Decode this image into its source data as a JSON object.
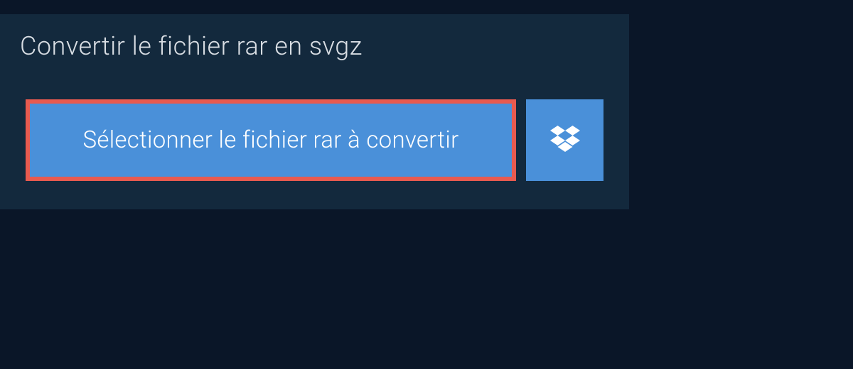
{
  "title": "Convertir le fichier rar en svgz",
  "buttons": {
    "select_file_label": "Sélectionner le fichier rar à convertir"
  }
}
